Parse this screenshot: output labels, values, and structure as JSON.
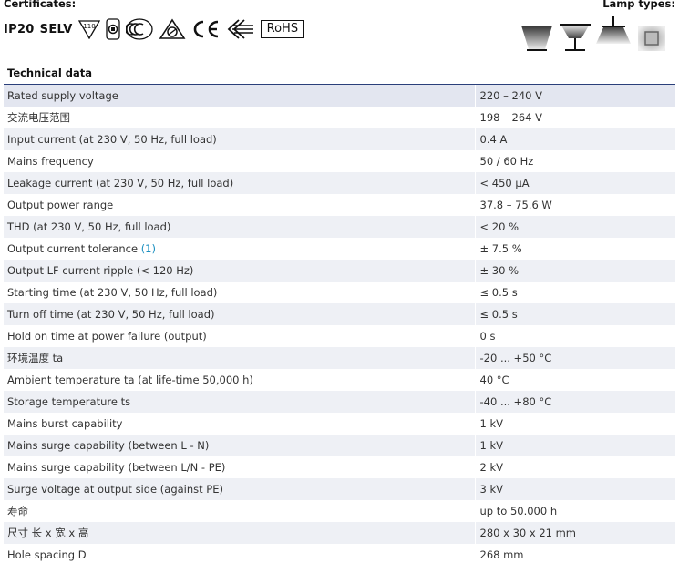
{
  "header": {
    "certificates_title": "Certificates:",
    "lamp_types_title": "Lamp types:"
  },
  "certificates": {
    "ip_rating": "IP20",
    "selv": "SELV",
    "temp_mark": "110",
    "rohs": "RoHS",
    "icons": [
      "temperature-triangle-icon",
      "double-insulation-icon",
      "rcm-icon",
      "enec-icon",
      "ce-icon",
      "emc-icon",
      "rohs-icon"
    ]
  },
  "lamp_types": {
    "icons": [
      "downlight-beam-icon",
      "table-lamp-icon",
      "pendant-lamp-icon",
      "square-panel-icon"
    ]
  },
  "technical_data": {
    "title": "Technical data",
    "rows": [
      {
        "label": "Rated supply voltage",
        "value": "220 – 240 V"
      },
      {
        "label": "交流电压范围",
        "value": "198 – 264 V"
      },
      {
        "label": "Input current (at 230 V, 50 Hz, full load)",
        "value": "0.4 A"
      },
      {
        "label": "Mains frequency",
        "value": "50 / 60 Hz"
      },
      {
        "label": "Leakage current (at 230 V, 50 Hz, full load)",
        "value": "< 450 µA"
      },
      {
        "label": "Output power range",
        "value": "37.8 – 75.6 W"
      },
      {
        "label": "THD (at 230 V, 50 Hz, full load)",
        "value": "< 20 %"
      },
      {
        "label": "Output current tolerance",
        "note": "(1)",
        "value": "± 7.5 %"
      },
      {
        "label": "Output LF current ripple (< 120 Hz)",
        "value": "± 30 %"
      },
      {
        "label": "Starting time (at 230 V, 50 Hz, full load)",
        "value": "≤ 0.5 s"
      },
      {
        "label": "Turn off time (at 230 V, 50 Hz, full load)",
        "value": "≤ 0.5 s"
      },
      {
        "label": "Hold on time at power failure (output)",
        "value": "0 s"
      },
      {
        "label": "环境温度 ta",
        "value": "-20 ... +50 °C"
      },
      {
        "label": "Ambient temperature ta (at life-time 50,000 h)",
        "value": "40 °C"
      },
      {
        "label": "Storage temperature ts",
        "value": "-40 ... +80 °C"
      },
      {
        "label": "Mains burst capability",
        "value": "1 kV"
      },
      {
        "label": "Mains surge capability (between L - N)",
        "value": "1 kV"
      },
      {
        "label": "Mains surge capability (between L/N - PE)",
        "value": "2 kV"
      },
      {
        "label": "Surge voltage at output side (against PE)",
        "value": "3 kV"
      },
      {
        "label": "寿命",
        "value": "up to 50.000 h"
      },
      {
        "label": "尺寸 长 x 宽 x 高",
        "value": "280 x 30 x 21 mm"
      },
      {
        "label": "Hole spacing D",
        "value": "268 mm"
      }
    ]
  }
}
